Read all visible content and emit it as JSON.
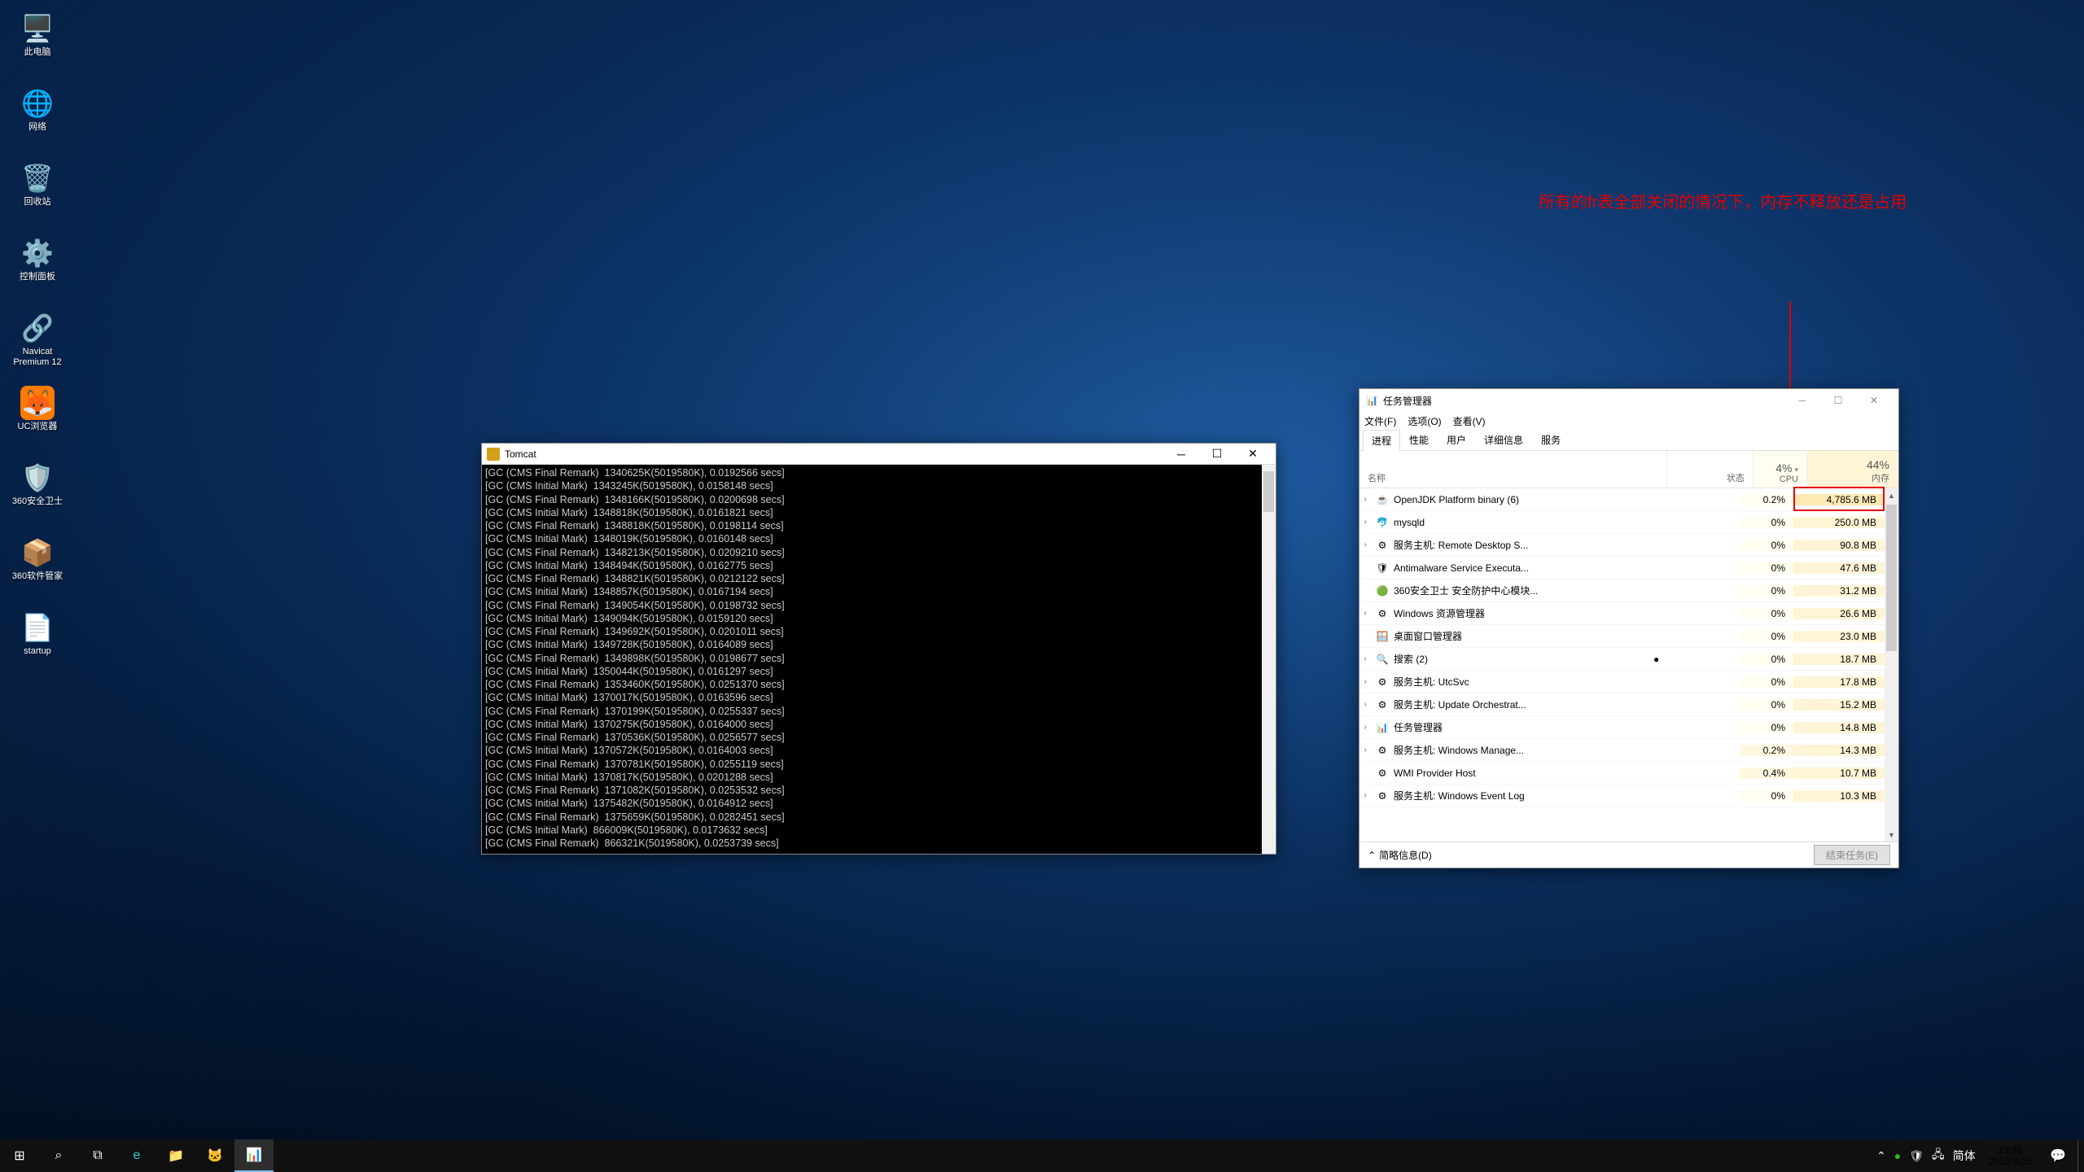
{
  "annotation": "所有的fr表全部关闭的情况下，内存不释放还是占用",
  "desktop": [
    {
      "label": "此电脑",
      "icon": "🖥️"
    },
    {
      "label": "网络",
      "icon": "🌐"
    },
    {
      "label": "回收站",
      "icon": "🗑️"
    },
    {
      "label": "控制面板",
      "icon": "⚙️"
    },
    {
      "label": "Navicat Premium 12",
      "icon": "🔗"
    },
    {
      "label": "UC浏览器",
      "icon": "🦊"
    },
    {
      "label": "360安全卫士",
      "icon": "🛡️"
    },
    {
      "label": "360软件管家",
      "icon": "📦"
    },
    {
      "label": "startup",
      "icon": "📄"
    }
  ],
  "tomcat": {
    "title": "Tomcat",
    "lines": [
      "[GC (CMS Final Remark)  1340625K(5019580K), 0.0192566 secs]",
      "[GC (CMS Initial Mark)  1343245K(5019580K), 0.0158148 secs]",
      "[GC (CMS Final Remark)  1348166K(5019580K), 0.0200698 secs]",
      "[GC (CMS Initial Mark)  1348818K(5019580K), 0.0161821 secs]",
      "[GC (CMS Final Remark)  1348818K(5019580K), 0.0198114 secs]",
      "[GC (CMS Initial Mark)  1348019K(5019580K), 0.0160148 secs]",
      "[GC (CMS Final Remark)  1348213K(5019580K), 0.0209210 secs]",
      "[GC (CMS Initial Mark)  1348494K(5019580K), 0.0162775 secs]",
      "[GC (CMS Final Remark)  1348821K(5019580K), 0.0212122 secs]",
      "[GC (CMS Initial Mark)  1348857K(5019580K), 0.0167194 secs]",
      "[GC (CMS Final Remark)  1349054K(5019580K), 0.0198732 secs]",
      "[GC (CMS Initial Mark)  1349094K(5019580K), 0.0159120 secs]",
      "[GC (CMS Final Remark)  1349692K(5019580K), 0.0201011 secs]",
      "[GC (CMS Initial Mark)  1349728K(5019580K), 0.0164089 secs]",
      "[GC (CMS Final Remark)  1349898K(5019580K), 0.0198677 secs]",
      "[GC (CMS Initial Mark)  1350044K(5019580K), 0.0161297 secs]",
      "[GC (CMS Final Remark)  1353460K(5019580K), 0.0251370 secs]",
      "[GC (CMS Initial Mark)  1370017K(5019580K), 0.0163596 secs]",
      "[GC (CMS Final Remark)  1370199K(5019580K), 0.0255337 secs]",
      "[GC (CMS Initial Mark)  1370275K(5019580K), 0.0164000 secs]",
      "[GC (CMS Final Remark)  1370536K(5019580K), 0.0256577 secs]",
      "[GC (CMS Initial Mark)  1370572K(5019580K), 0.0164003 secs]",
      "[GC (CMS Final Remark)  1370781K(5019580K), 0.0255119 secs]",
      "[GC (CMS Initial Mark)  1370817K(5019580K), 0.0201288 secs]",
      "[GC (CMS Final Remark)  1371082K(5019580K), 0.0253532 secs]",
      "[GC (CMS Initial Mark)  1375482K(5019580K), 0.0164912 secs]",
      "[GC (CMS Final Remark)  1375659K(5019580K), 0.0282451 secs]",
      "[GC (CMS Initial Mark)  866009K(5019580K), 0.0173632 secs]",
      "[GC (CMS Final Remark)  866321K(5019580K), 0.0253739 secs]",
      "_"
    ]
  },
  "taskmgr": {
    "title": "任务管理器",
    "menus": [
      "文件(F)",
      "选项(O)",
      "查看(V)"
    ],
    "tabs": [
      "进程",
      "性能",
      "用户",
      "详细信息",
      "服务"
    ],
    "activeTab": 0,
    "columns": {
      "name": "名称",
      "status": "状态",
      "cpu_pct": "4%",
      "cpu": "CPU",
      "mem_pct": "44%",
      "mem": "内存"
    },
    "rows": [
      {
        "exp": "›",
        "icon": "☕",
        "name": "OpenJDK Platform binary (6)",
        "cpu": "0.2%",
        "mem": "4,785.6 MB",
        "hl": true
      },
      {
        "exp": "›",
        "icon": "🐬",
        "name": "mysqld",
        "cpu": "0%",
        "mem": "250.0 MB"
      },
      {
        "exp": "›",
        "icon": "⚙",
        "name": "服务主机: Remote Desktop S...",
        "cpu": "0%",
        "mem": "90.8 MB"
      },
      {
        "exp": "",
        "icon": "🛡",
        "name": "Antimalware Service Executa...",
        "cpu": "0%",
        "mem": "47.6 MB"
      },
      {
        "exp": "",
        "icon": "🟢",
        "name": "360安全卫士 安全防护中心模块...",
        "cpu": "0%",
        "mem": "31.2 MB"
      },
      {
        "exp": "›",
        "icon": "⚙",
        "name": "Windows 资源管理器",
        "cpu": "0%",
        "mem": "26.6 MB"
      },
      {
        "exp": "",
        "icon": "🪟",
        "name": "桌面窗口管理器",
        "cpu": "0%",
        "mem": "23.0 MB"
      },
      {
        "exp": "›",
        "icon": "🔍",
        "name": "搜索 (2)",
        "status": "●",
        "cpu": "0%",
        "mem": "18.7 MB"
      },
      {
        "exp": "›",
        "icon": "⚙",
        "name": "服务主机: UtcSvc",
        "cpu": "0%",
        "mem": "17.8 MB"
      },
      {
        "exp": "›",
        "icon": "⚙",
        "name": "服务主机: Update Orchestrat...",
        "cpu": "0%",
        "mem": "15.2 MB"
      },
      {
        "exp": "›",
        "icon": "📊",
        "name": "任务管理器",
        "cpu": "0%",
        "mem": "14.8 MB"
      },
      {
        "exp": "›",
        "icon": "⚙",
        "name": "服务主机: Windows Manage...",
        "cpu": "0.2%",
        "mem": "14.3 MB",
        "hl2": true
      },
      {
        "exp": "",
        "icon": "⚙",
        "name": "WMI Provider Host",
        "cpu": "0.4%",
        "mem": "10.7 MB",
        "hl2": true
      },
      {
        "exp": "›",
        "icon": "⚙",
        "name": "服务主机: Windows Event Log",
        "cpu": "0%",
        "mem": "10.3 MB"
      }
    ],
    "footer_less": "简略信息(D)",
    "footer_end": "结束任务(E)"
  },
  "taskbar": {
    "tray_lang": "简体",
    "clock_time": "13:38",
    "clock_date": "2019/9/25"
  }
}
